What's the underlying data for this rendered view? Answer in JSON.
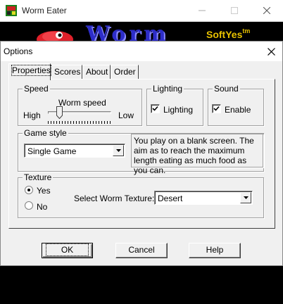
{
  "app": {
    "title": "Worm Eater",
    "banner_word": "Worm",
    "banner_company": "SoftYes",
    "banner_tm": "tm"
  },
  "dialog": {
    "title": "Options",
    "tabs": [
      {
        "label": "Properties",
        "active": true
      },
      {
        "label": "Scores",
        "active": false
      },
      {
        "label": "About",
        "active": false
      },
      {
        "label": "Order",
        "active": false
      }
    ],
    "speed": {
      "group_label": "Speed",
      "slider_label": "Worm speed",
      "high_label": "High",
      "low_label": "Low",
      "value_fraction": 0.15
    },
    "lighting": {
      "group_label": "Lighting",
      "checkbox_label": "Lighting",
      "checked": true
    },
    "sound": {
      "group_label": "Sound",
      "checkbox_label": "Enable",
      "checked": true
    },
    "game_style": {
      "group_label": "Game style",
      "selected": "Single Game",
      "description": "You play on a blank screen. The aim as to reach the maximum length eating as much food as you can."
    },
    "texture": {
      "group_label": "Texture",
      "yes_label": "Yes",
      "no_label": "No",
      "selected_option": "Yes",
      "select_label": "Select Worm Texture:",
      "selected_texture": "Desert"
    },
    "buttons": {
      "ok": "OK",
      "cancel": "Cancel",
      "help": "Help"
    }
  },
  "icons": [
    "app-icon",
    "minimize-icon",
    "maximize-icon",
    "close-icon",
    "dropdown-arrow-icon",
    "checkmark-icon",
    "worm-logo-icon"
  ],
  "colors": {
    "dialog_bg": "#f0f0f0",
    "banner_text": "#2d2dc8",
    "banner_company": "#e8c200",
    "worm_red": "#e0202a"
  }
}
